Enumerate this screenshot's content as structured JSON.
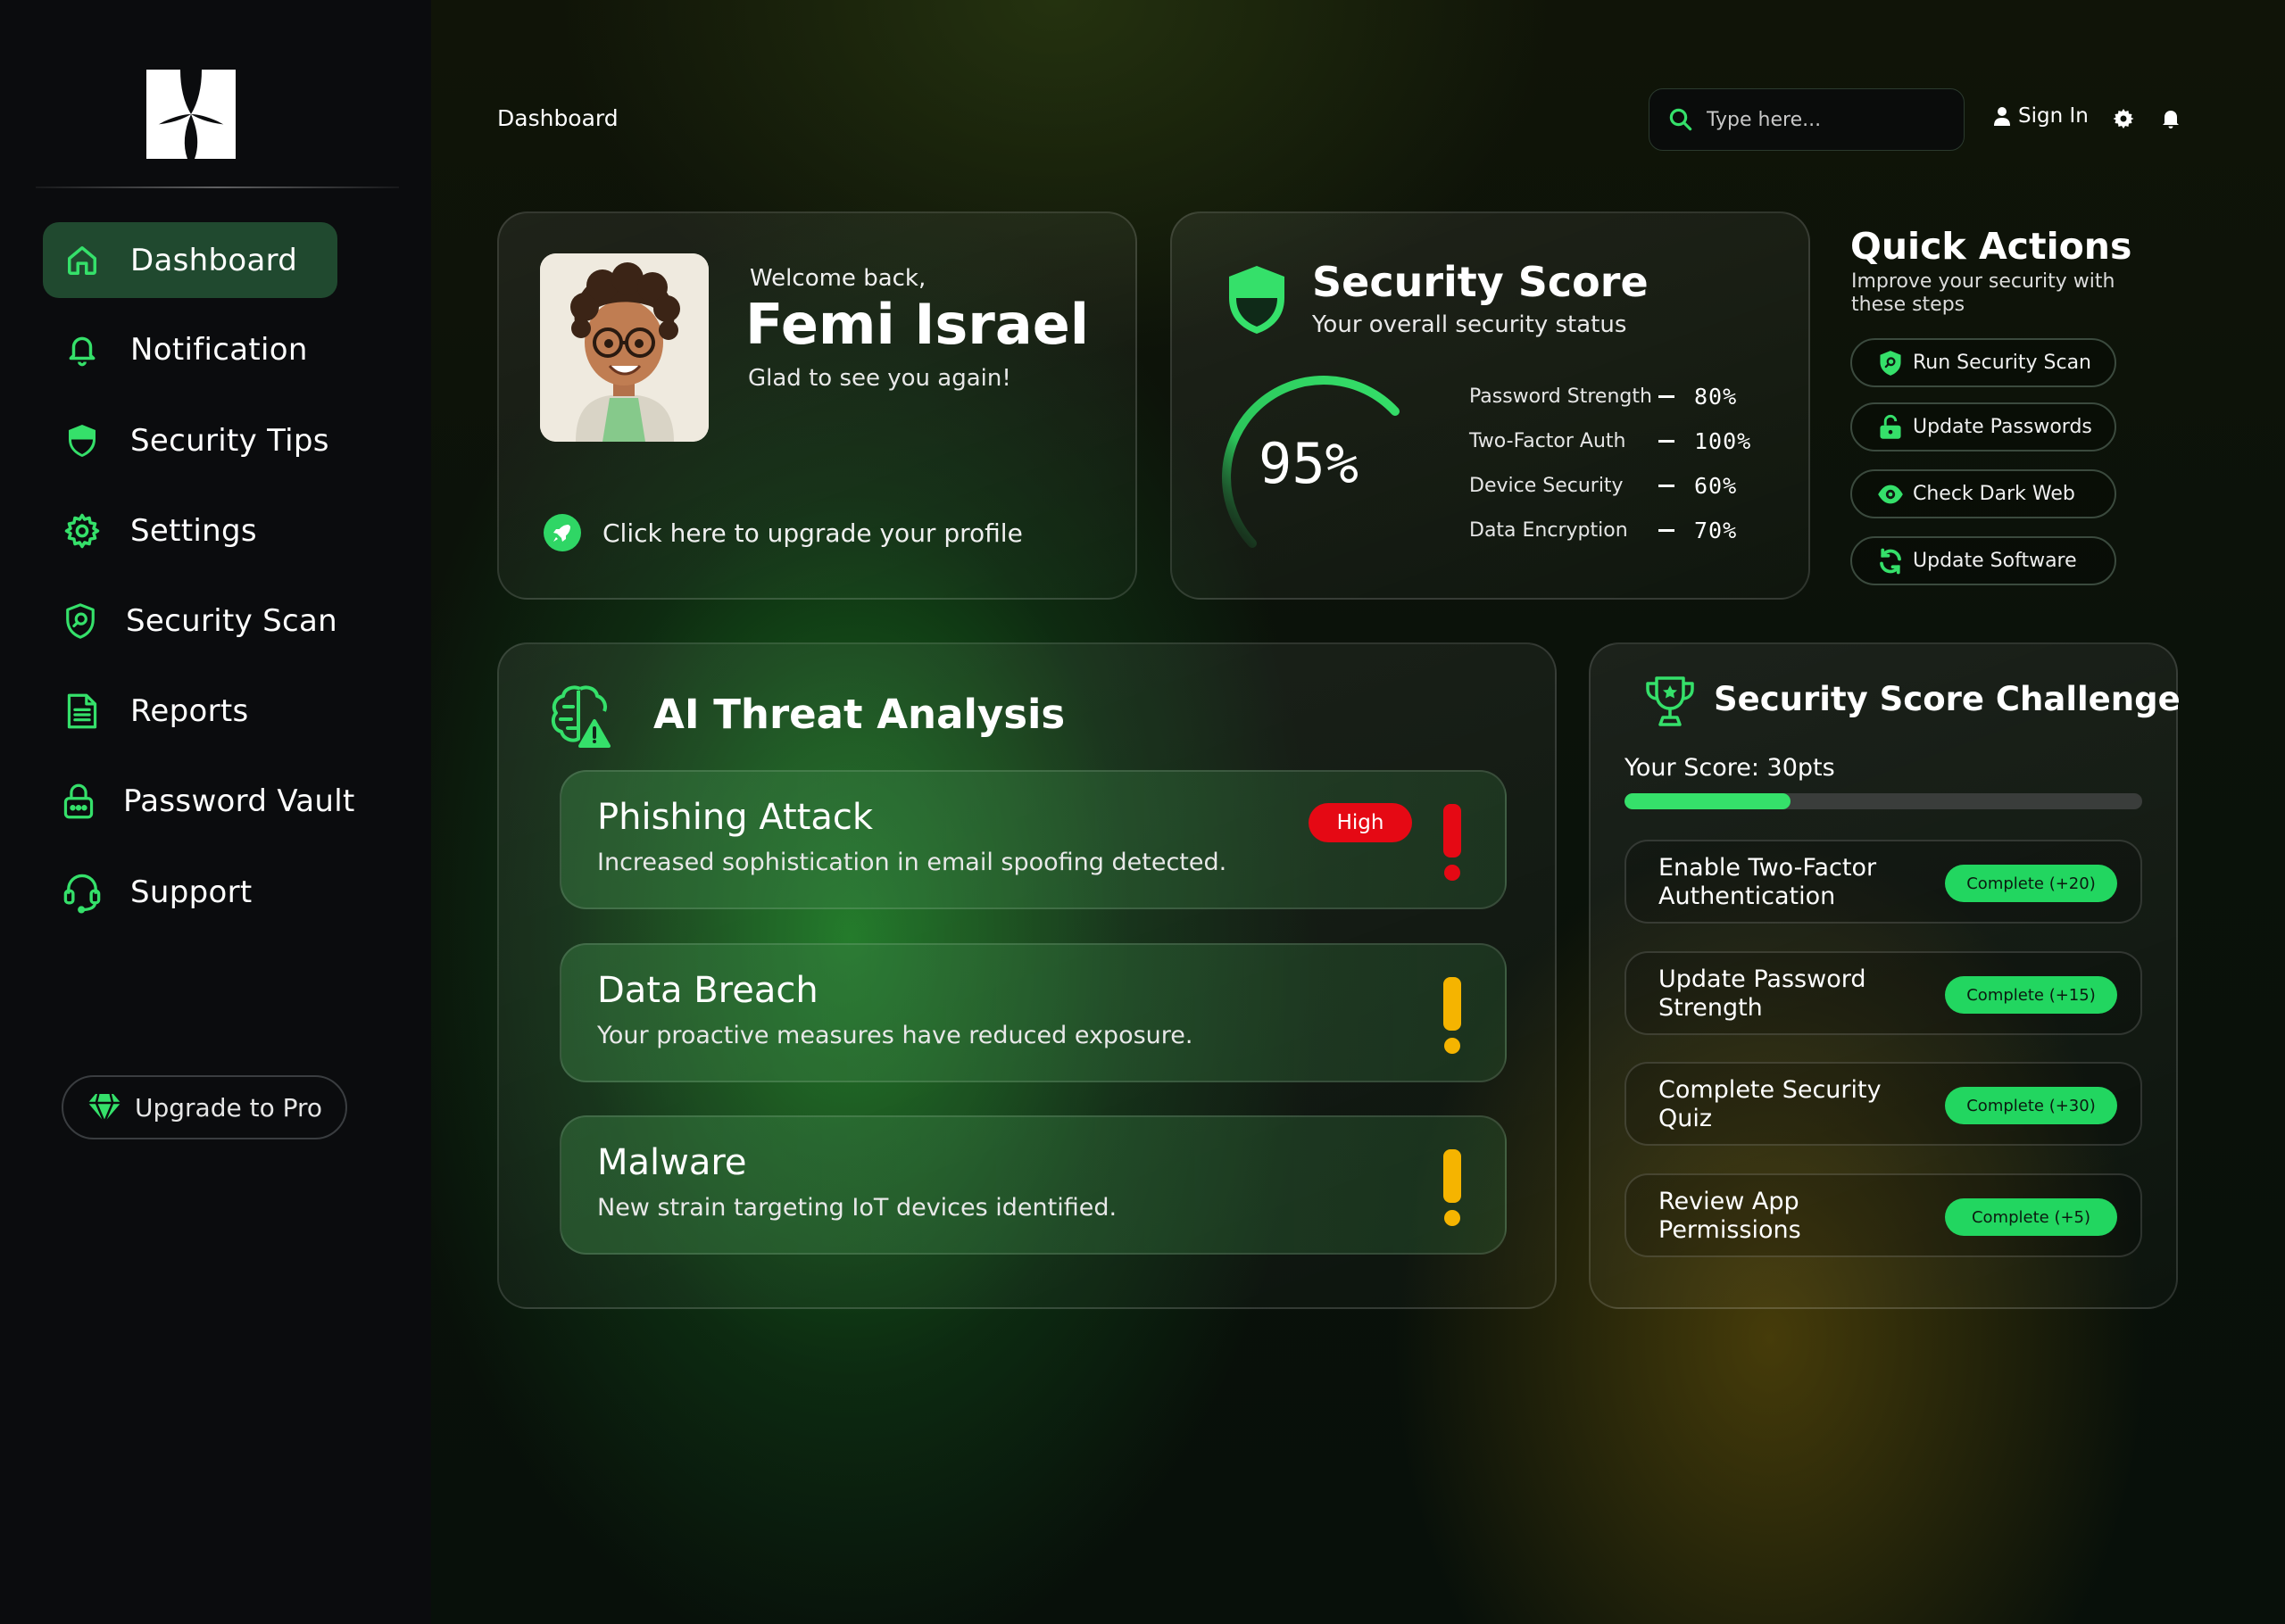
{
  "colors": {
    "accent": "#22d660",
    "sidebar_bg": "#0b0c0e",
    "active_nav_bg": "#20492f",
    "danger": "#e50914",
    "warning": "#f5b400"
  },
  "sidebar": {
    "items": [
      {
        "label": "Dashboard",
        "icon": "home-icon",
        "active": true
      },
      {
        "label": "Notification",
        "icon": "bell-icon"
      },
      {
        "label": "Security Tips",
        "icon": "shield-icon"
      },
      {
        "label": "Settings",
        "icon": "gear-icon"
      },
      {
        "label": "Security Scan",
        "icon": "shield-search-icon"
      },
      {
        "label": "Reports",
        "icon": "document-icon"
      },
      {
        "label": "Password Vault",
        "icon": "lock-icon"
      },
      {
        "label": "Support",
        "icon": "headset-icon"
      }
    ],
    "upgrade_label": "Upgrade to Pro"
  },
  "header": {
    "breadcrumb": "Dashboard",
    "search_placeholder": "Type here...",
    "sign_in": "Sign In"
  },
  "welcome": {
    "greeting": "Welcome  back,",
    "name": "Femi Israel",
    "subtitle": "Glad to see you again!",
    "upgrade_link": "Click here to upgrade your profile"
  },
  "security_score": {
    "title": "Security Score",
    "subtitle": "Your overall security status",
    "score_label": "95%",
    "score_value": 95,
    "metrics": [
      {
        "label": "Password Strength",
        "value": "80%"
      },
      {
        "label": "Two-Factor Auth",
        "value": "100%"
      },
      {
        "label": "Device Security",
        "value": "60%"
      },
      {
        "label": "Data Encryption",
        "value": "70%"
      }
    ]
  },
  "quick_actions": {
    "title": "Quick Actions",
    "subtitle": "Improve your security with these steps",
    "buttons": [
      {
        "label": "Run Security Scan",
        "icon": "shield-search-icon"
      },
      {
        "label": "Update Passwords",
        "icon": "unlock-icon"
      },
      {
        "label": "Check Dark Web",
        "icon": "eye-icon"
      },
      {
        "label": "Update Software",
        "icon": "refresh-icon"
      }
    ]
  },
  "threats": {
    "title": "AI Threat Analysis",
    "items": [
      {
        "name": "Phishing Attack",
        "description": "Increased sophistication in email spoofing detected.",
        "badge": "High",
        "severity_color": "#e50914"
      },
      {
        "name": "Data Breach",
        "description": "Your proactive measures have reduced exposure.",
        "severity_color": "#f5b400"
      },
      {
        "name": "Malware",
        "description": "New strain targeting IoT devices identified.",
        "severity_color": "#f5b400"
      }
    ]
  },
  "challenge": {
    "title": "Security Score Challenge",
    "your_score": "Your Score: 30pts",
    "progress_fraction": 0.32,
    "items": [
      {
        "name": "Enable Two-Factor Authentication",
        "button": "Complete (+20)"
      },
      {
        "name": "Update Password Strength",
        "button": "Complete (+15)"
      },
      {
        "name": "Complete Security Quiz",
        "button": "Complete (+30)"
      },
      {
        "name": "Review App Permissions",
        "button": "Complete (+5)"
      }
    ]
  }
}
